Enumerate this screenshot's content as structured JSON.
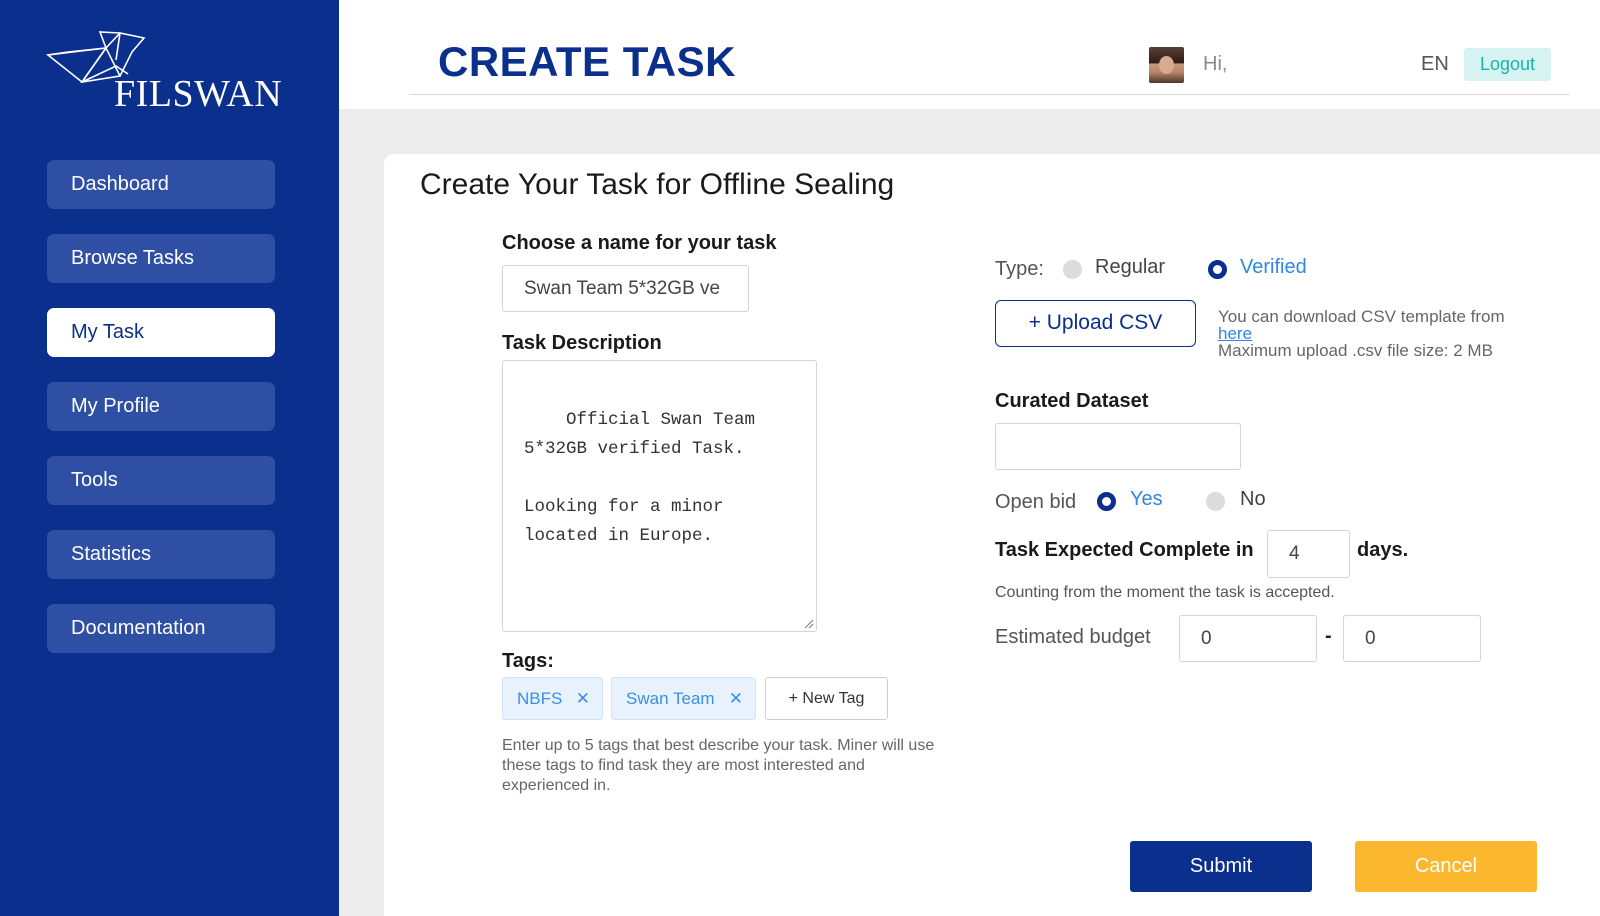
{
  "brand": {
    "name": "FILSWAN"
  },
  "sidebar": {
    "items": [
      {
        "label": "Dashboard"
      },
      {
        "label": "Browse Tasks"
      },
      {
        "label": "My Task",
        "active": true
      },
      {
        "label": "My Profile"
      },
      {
        "label": "Tools"
      },
      {
        "label": "Statistics"
      },
      {
        "label": "Documentation"
      }
    ]
  },
  "header": {
    "title": "CREATE TASK",
    "greeting": "Hi,",
    "language": "EN",
    "logout_label": "Logout"
  },
  "form": {
    "title": "Create Your Task for Offline Sealing",
    "name_label": "Choose a name for your task",
    "name_value": "Swan Team 5*32GB ve",
    "description_label": "Task Description",
    "description_value": "Official Swan Team\n5*32GB verified Task.\n\nLooking for a minor\nlocated in Europe.",
    "tags_label": "Tags:",
    "tags": [
      {
        "label": "NBFS"
      },
      {
        "label": "Swan Team"
      }
    ],
    "new_tag_label": "+ New Tag",
    "tags_hint": "Enter up to 5 tags that best describe your task. Miner will use these tags to find task they are most interested and experienced in.",
    "type_label": "Type:",
    "type_options": [
      {
        "label": "Regular",
        "selected": false
      },
      {
        "label": "Verified",
        "selected": true
      }
    ],
    "upload_label": "+ Upload CSV",
    "csv_note_prefix": "You can download CSV template from",
    "csv_note_link": " here",
    "csv_note_limit": "Maximum upload .csv file size: 2 MB",
    "curated_label": "Curated Dataset",
    "curated_value": "",
    "open_bid_label": "Open bid",
    "open_bid_options": [
      {
        "label": "Yes",
        "selected": true
      },
      {
        "label": "No",
        "selected": false
      }
    ],
    "expected_label": "Task Expected Complete in",
    "expected_value": "4",
    "expected_unit": "days.",
    "expected_hint": "Counting from the moment the task is accepted.",
    "budget_label": "Estimated budget",
    "budget_min": "0",
    "budget_sep": "-",
    "budget_max": "0",
    "submit_label": "Submit",
    "cancel_label": "Cancel"
  },
  "colors": {
    "sidebar": "#0b2f8c",
    "accent_blue": "#2f86e6",
    "submit": "#0b2f8c",
    "cancel": "#fbb72e",
    "logout_bg": "#d6f3f2"
  }
}
